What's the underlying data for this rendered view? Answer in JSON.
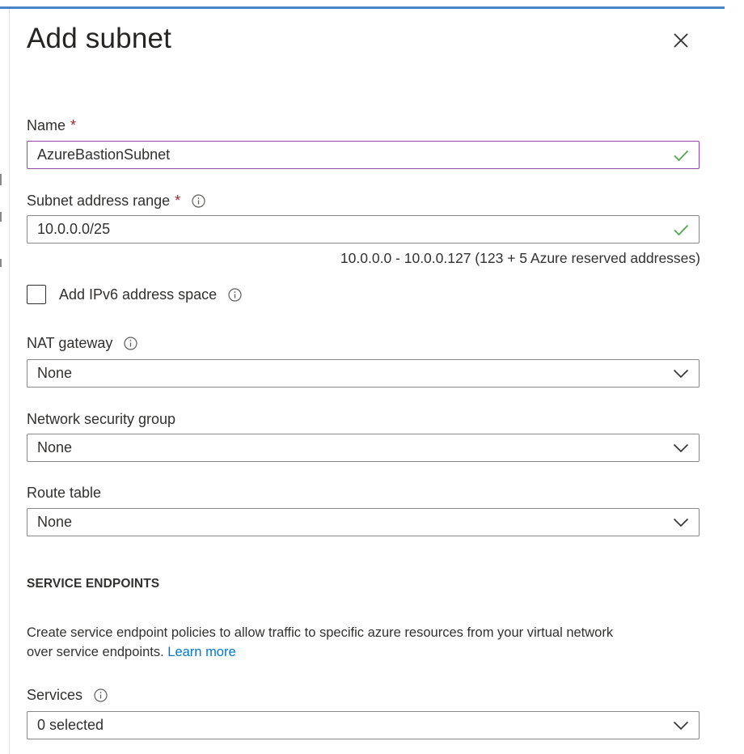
{
  "panel": {
    "title": "Add subnet",
    "close_icon": "close-icon"
  },
  "name_field": {
    "label": "Name",
    "required_mark": "*",
    "value": "AzureBastionSubnet",
    "valid_icon": "checkmark-icon"
  },
  "address_range": {
    "label": "Subnet address range",
    "required_mark": "*",
    "value": "10.0.0.0/25",
    "helper": "10.0.0.0 - 10.0.0.127 (123 + 5 Azure reserved addresses)",
    "info_icon": "info-icon",
    "valid_icon": "checkmark-icon"
  },
  "ipv6": {
    "label": "Add IPv6 address space",
    "checked": false,
    "info_icon": "info-icon"
  },
  "nat_gateway": {
    "label": "NAT gateway",
    "selected": "None",
    "info_icon": "info-icon"
  },
  "nsg": {
    "label": "Network security group",
    "selected": "None"
  },
  "route_table": {
    "label": "Route table",
    "selected": "None"
  },
  "service_endpoints": {
    "section_title": "SERVICE ENDPOINTS",
    "description_line1": "Create service endpoint policies to allow traffic to specific azure resources from your virtual network",
    "description_line2": "over service endpoints.",
    "learn_more": "Learn more"
  },
  "services": {
    "label": "Services",
    "selected": "0 selected",
    "info_icon": "info-icon"
  },
  "colors": {
    "accent": "#4a84c8",
    "focus_border": "#8f4aa8",
    "valid_check": "#4fa84f",
    "required": "#a4262c",
    "link": "#0078d4"
  }
}
